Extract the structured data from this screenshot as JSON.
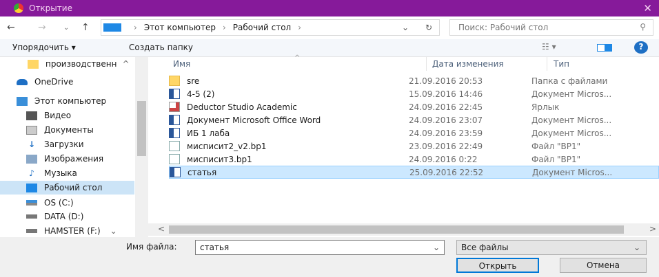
{
  "title": "Открытие",
  "address": {
    "crumbs": [
      "Этот компьютер",
      "Рабочий стол"
    ],
    "search_placeholder": "Поиск: Рабочий стол"
  },
  "toolbar": {
    "organize": "Упорядочить ▾",
    "new_folder": "Создать папку"
  },
  "sidebar": [
    {
      "label": "производственн",
      "icon": "folder-icon"
    },
    {
      "label": "OneDrive",
      "icon": "cloud-icon"
    },
    {
      "label": "Этот компьютер",
      "icon": "computer-icon"
    },
    {
      "label": "Видео",
      "icon": "video-icon"
    },
    {
      "label": "Документы",
      "icon": "documents-icon"
    },
    {
      "label": "Загрузки",
      "icon": "downloads-icon"
    },
    {
      "label": "Изображения",
      "icon": "pictures-icon"
    },
    {
      "label": "Музыка",
      "icon": "music-icon"
    },
    {
      "label": "Рабочий стол",
      "icon": "desktop-icon"
    },
    {
      "label": "OS (C:)",
      "icon": "drive-icon"
    },
    {
      "label": "DATA (D:)",
      "icon": "drive-icon"
    },
    {
      "label": "HAMSTER (F:)",
      "icon": "drive-icon"
    }
  ],
  "columns": {
    "name": "Имя",
    "date": "Дата изменения",
    "type": "Тип"
  },
  "files": [
    {
      "name": "sre",
      "date": "21.09.2016 20:53",
      "type": "Папка с файлами",
      "kind": "folder"
    },
    {
      "name": "4-5 (2)",
      "date": "15.09.2016 14:46",
      "type": "Документ Micros...",
      "kind": "word"
    },
    {
      "name": "Deductor Studio Academic",
      "date": "24.09.2016 22:45",
      "type": "Ярлык",
      "kind": "lnk"
    },
    {
      "name": "Документ Microsoft Office Word",
      "date": "24.09.2016 23:07",
      "type": "Документ Micros...",
      "kind": "word"
    },
    {
      "name": "ИБ 1 лаба",
      "date": "24.09.2016 23:59",
      "type": "Документ Micros...",
      "kind": "word"
    },
    {
      "name": "миспиcит2_v2.bp1",
      "date": "23.09.2016 22:49",
      "type": "Файл \"BP1\"",
      "kind": "file"
    },
    {
      "name": "миспиcит3.bp1",
      "date": "24.09.2016 0:22",
      "type": "Файл \"BP1\"",
      "kind": "file"
    },
    {
      "name": "статья",
      "date": "25.09.2016 22:52",
      "type": "Документ Micros...",
      "kind": "word"
    }
  ],
  "bottom": {
    "filename_label": "Имя файла:",
    "filename_value": "статья",
    "filter": "Все файлы",
    "open": "Открыть",
    "cancel": "Отмена"
  }
}
